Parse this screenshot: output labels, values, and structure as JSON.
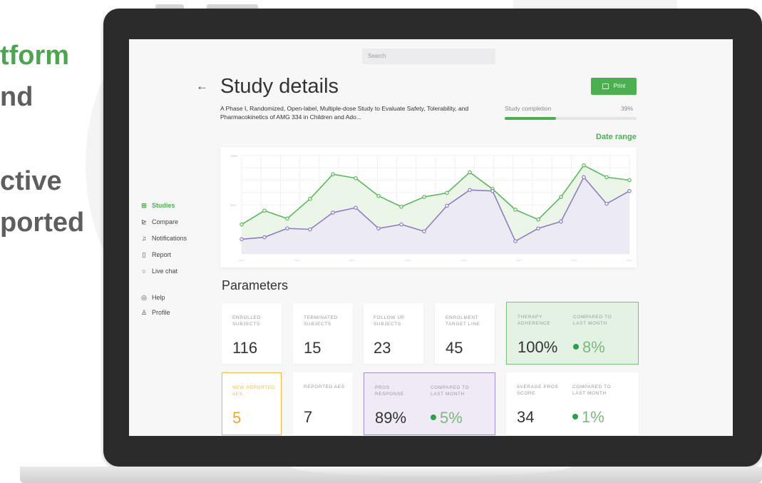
{
  "promo": {
    "line1": "tform",
    "line2": "nd",
    "line3": "ctive",
    "line4": "ported"
  },
  "search": {
    "placeholder": "Search"
  },
  "header": {
    "title": "Study details",
    "subtitle": "A Phase I, Randomized, Open-label, Multiple-dose Study to Evaluate Safety, Tolerability, and Pharmacokinetics of AMG 334 in Children and Ado...",
    "print_label": "Print",
    "completion_label": "Study completion",
    "completion_value": "39%",
    "completion_fraction": 0.39,
    "date_range_label": "Date range"
  },
  "sidebar": {
    "items": [
      {
        "label": "Studies",
        "icon": "grid-icon",
        "active": true
      },
      {
        "label": "Compare",
        "icon": "chart-icon",
        "active": false
      },
      {
        "label": "Notifications",
        "icon": "bell-icon",
        "active": false
      },
      {
        "label": "Report",
        "icon": "document-icon",
        "active": false
      },
      {
        "label": "Live chat",
        "icon": "chat-icon",
        "active": false
      },
      {
        "label": "Help",
        "icon": "help-icon",
        "active": false
      },
      {
        "label": "Profile",
        "icon": "user-icon",
        "active": false
      }
    ]
  },
  "chart_data": {
    "type": "area",
    "ylim": [
      0,
      100
    ],
    "y_ticks": [
      "100%",
      "50%"
    ],
    "x_tick_count": 8,
    "series": [
      {
        "color": "#5cb85c",
        "values": [
          30,
          44,
          36,
          56,
          81,
          77,
          59,
          48,
          58,
          62,
          83,
          66,
          45,
          35,
          58,
          90,
          78,
          75
        ]
      },
      {
        "color": "#8e7cc3",
        "values": [
          15,
          17,
          26,
          25,
          42,
          47,
          26,
          30,
          23,
          49,
          65,
          64,
          13,
          26,
          33,
          78,
          51,
          64
        ]
      }
    ],
    "colors": {
      "grid": "#f0f0f0",
      "green_fill": "#e8f5e5",
      "purple_fill": "#ece9f5"
    }
  },
  "parameters": {
    "title": "Parameters",
    "row1": [
      {
        "label": "ENROLLED SUBJECTS",
        "value": "116"
      },
      {
        "label": "TERMINATED SUBJECTS",
        "value": "15"
      },
      {
        "label": "FOLLOW UP SUBJECTS",
        "value": "23"
      },
      {
        "label": "ENROLMENT TARGET LINE",
        "value": "45"
      },
      {
        "label": "THERAPY ADHERENCE",
        "value": "100%",
        "compare_label": "COMPARED TO LAST MONTH",
        "delta": "8%"
      }
    ],
    "row2": [
      {
        "label": "NEW REPORTED AES",
        "value": "5"
      },
      {
        "label": "REPORTED AES",
        "value": "7"
      },
      {
        "label": "PROS RESPONSE",
        "value": "89%",
        "compare_label": "COMPARED TO LAST MONTH",
        "delta": "5%"
      },
      {
        "label": "AVERAGE PROS SCORE",
        "value": "34",
        "compare_label": "COMPARED TO LAST MONTH",
        "delta": "1%"
      }
    ]
  }
}
